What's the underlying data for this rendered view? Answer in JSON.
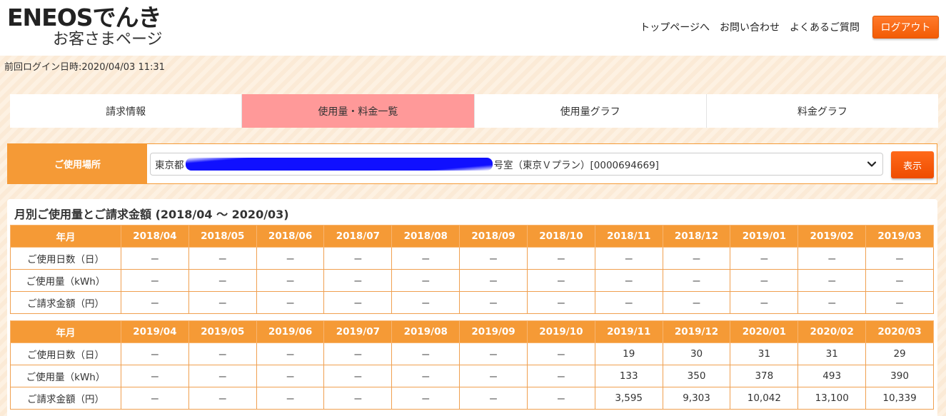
{
  "header": {
    "logo_main": "ENEOSでんき",
    "logo_sub": "お客さまページ",
    "nav": [
      "トップページへ",
      "お問い合わせ",
      "よくあるご質問"
    ],
    "logout_label": "ログアウト"
  },
  "last_login": "前回ログイン日時:2020/04/03 11:31",
  "tabs": [
    {
      "label": "請求情報",
      "active": false
    },
    {
      "label": "使用量・料金一覧",
      "active": true
    },
    {
      "label": "使用量グラフ",
      "active": false
    },
    {
      "label": "料金グラフ",
      "active": false
    }
  ],
  "place": {
    "label": "ご使用場所",
    "select_prefix": "東京都",
    "select_suffix": "号室（東京Ｖプラン）[0000694669]",
    "show_label": "表示"
  },
  "panel": {
    "title": "月別ご使用量とご請求金額 (2018/04 ～ 2020/03)"
  },
  "tables": [
    {
      "header_label": "年月",
      "months": [
        "2018/04",
        "2018/05",
        "2018/06",
        "2018/07",
        "2018/08",
        "2018/09",
        "2018/10",
        "2018/11",
        "2018/12",
        "2019/01",
        "2019/02",
        "2019/03"
      ],
      "rows": [
        {
          "label": "ご使用日数（日）",
          "values": [
            "－",
            "－",
            "－",
            "－",
            "－",
            "－",
            "－",
            "－",
            "－",
            "－",
            "－",
            "－"
          ]
        },
        {
          "label": "ご使用量（kWh）",
          "values": [
            "－",
            "－",
            "－",
            "－",
            "－",
            "－",
            "－",
            "－",
            "－",
            "－",
            "－",
            "－"
          ]
        },
        {
          "label": "ご請求金額（円）",
          "values": [
            "－",
            "－",
            "－",
            "－",
            "－",
            "－",
            "－",
            "－",
            "－",
            "－",
            "－",
            "－"
          ]
        }
      ]
    },
    {
      "header_label": "年月",
      "months": [
        "2019/04",
        "2019/05",
        "2019/06",
        "2019/07",
        "2019/08",
        "2019/09",
        "2019/10",
        "2019/11",
        "2019/12",
        "2020/01",
        "2020/02",
        "2020/03"
      ],
      "rows": [
        {
          "label": "ご使用日数（日）",
          "values": [
            "－",
            "－",
            "－",
            "－",
            "－",
            "－",
            "－",
            "19",
            "30",
            "31",
            "31",
            "29"
          ]
        },
        {
          "label": "ご使用量（kWh）",
          "values": [
            "－",
            "－",
            "－",
            "－",
            "－",
            "－",
            "－",
            "133",
            "350",
            "378",
            "493",
            "390"
          ]
        },
        {
          "label": "ご請求金額（円）",
          "values": [
            "－",
            "－",
            "－",
            "－",
            "－",
            "－",
            "－",
            "3,595",
            "9,303",
            "10,042",
            "13,100",
            "10,339"
          ]
        }
      ]
    }
  ]
}
